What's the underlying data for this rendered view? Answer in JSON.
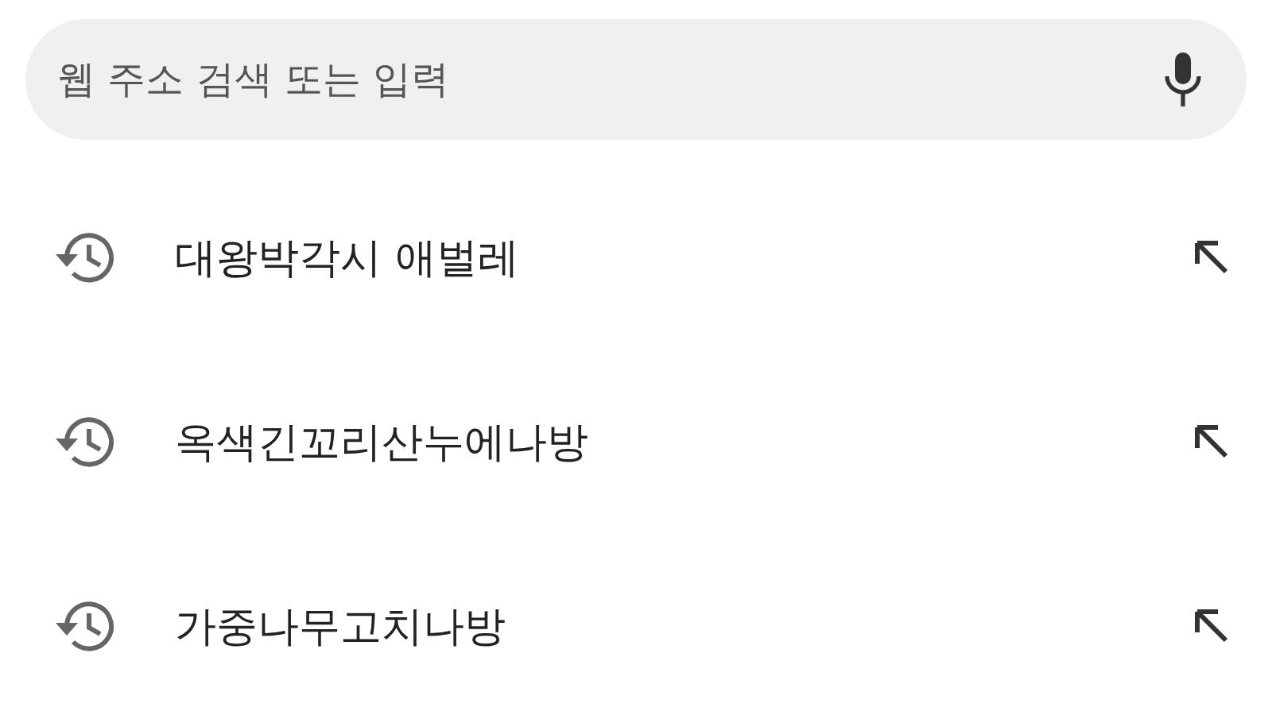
{
  "search": {
    "placeholder": "웹 주소 검색 또는 입력"
  },
  "suggestions": [
    {
      "text": "대왕박각시 애벌레"
    },
    {
      "text": "옥색긴꼬리산누에나방"
    },
    {
      "text": "가중나무고치나방"
    }
  ]
}
